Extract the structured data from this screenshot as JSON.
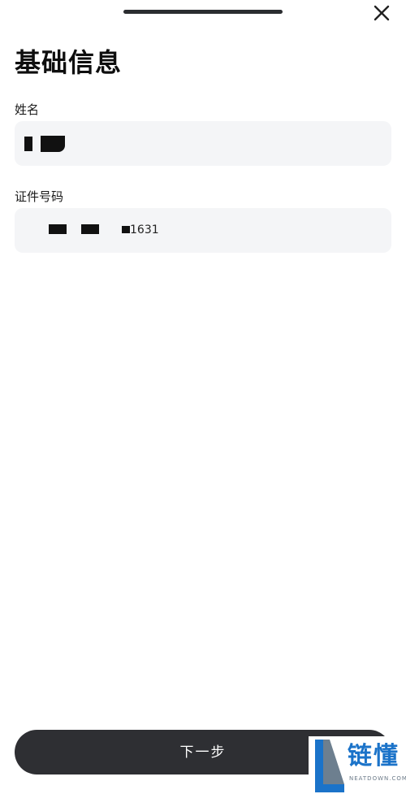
{
  "header": {
    "close_icon": "close-icon"
  },
  "page": {
    "title": "基础信息"
  },
  "form": {
    "name": {
      "label": "姓名",
      "value": ""
    },
    "id_number": {
      "label": "证件号码",
      "value": "1631"
    }
  },
  "footer": {
    "next_label": "下一步"
  },
  "watermark": {
    "text": "链懂",
    "sub": "NEATDOWN.COM"
  },
  "colors": {
    "primary_button": "#2e2f33",
    "input_bg": "#f4f5f7",
    "watermark": "#1b73c9"
  }
}
